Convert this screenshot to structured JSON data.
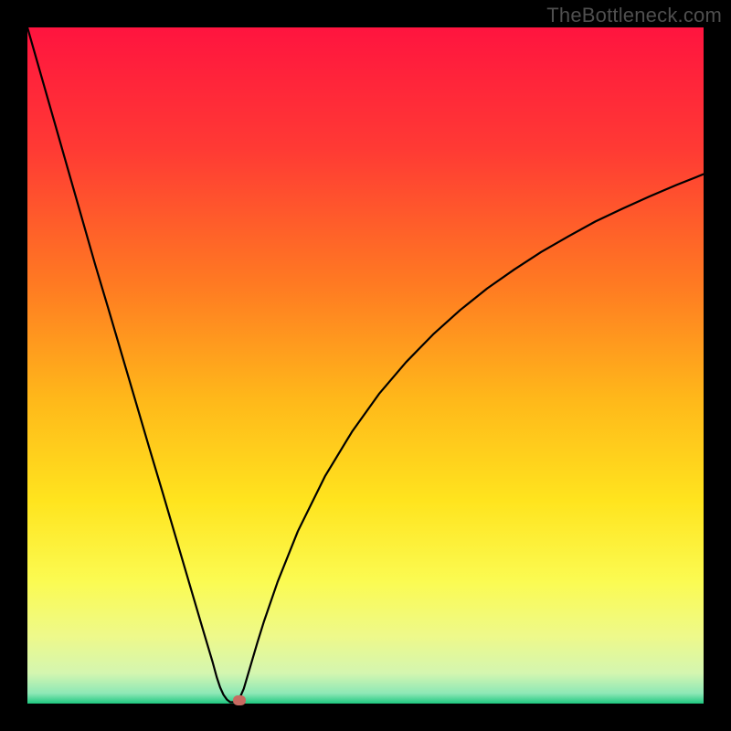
{
  "attribution": "TheBottleneck.com",
  "colors": {
    "frame": "#000000",
    "curve": "#000000",
    "gradient_stops": [
      {
        "pos": 0.0,
        "color": "#ff143f"
      },
      {
        "pos": 0.18,
        "color": "#ff3a34"
      },
      {
        "pos": 0.38,
        "color": "#ff7a22"
      },
      {
        "pos": 0.55,
        "color": "#ffb81a"
      },
      {
        "pos": 0.7,
        "color": "#ffe41e"
      },
      {
        "pos": 0.82,
        "color": "#fbfb52"
      },
      {
        "pos": 0.9,
        "color": "#eef98a"
      },
      {
        "pos": 0.955,
        "color": "#d4f6b0"
      },
      {
        "pos": 0.985,
        "color": "#8de8b6"
      },
      {
        "pos": 1.0,
        "color": "#1ec780"
      }
    ],
    "marker_fill": "#c76a61"
  },
  "chart_data": {
    "type": "line",
    "title": "",
    "xlabel": "",
    "ylabel": "",
    "xlim": [
      0,
      100
    ],
    "ylim": [
      0,
      100
    ],
    "grid": false,
    "series": [
      {
        "name": "curve",
        "x": [
          0,
          2,
          4,
          6,
          8,
          10,
          12,
          14,
          16,
          18,
          20,
          22,
          24,
          26,
          27.4,
          28,
          28.5,
          29.0,
          29.5,
          30.0,
          30.5,
          31.0,
          31.3,
          32,
          33,
          34,
          35,
          37,
          40,
          44,
          48,
          52,
          56,
          60,
          64,
          68,
          72,
          76,
          80,
          84,
          88,
          92,
          96,
          100
        ],
        "y": [
          100,
          93,
          86,
          79,
          72,
          65,
          58.3,
          51.5,
          44.7,
          37.9,
          31.2,
          24.4,
          17.6,
          10.8,
          6.1,
          3.9,
          2.4,
          1.3,
          0.6,
          0.2,
          0.2,
          0.4,
          0.6,
          2.2,
          5.6,
          9.0,
          12.2,
          18.0,
          25.5,
          33.6,
          40.2,
          45.8,
          50.5,
          54.6,
          58.2,
          61.4,
          64.2,
          66.8,
          69.1,
          71.3,
          73.2,
          75.0,
          76.7,
          78.3
        ]
      }
    ],
    "marker": {
      "x": 31.3,
      "y": 0.6
    }
  }
}
